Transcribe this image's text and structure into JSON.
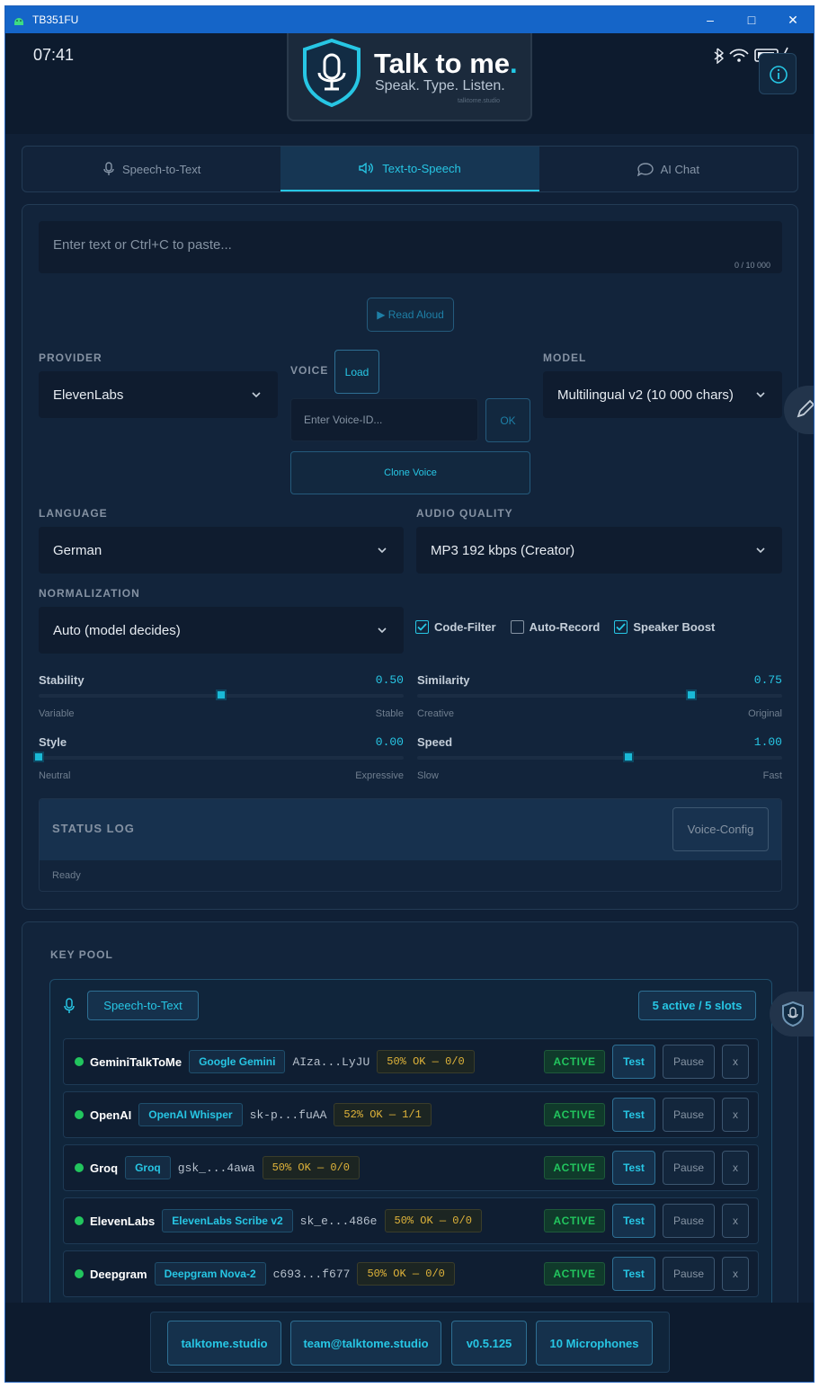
{
  "window": {
    "title": "TB351FU"
  },
  "statusbar": {
    "time": "07:41"
  },
  "logo": {
    "title": "Talk to me",
    "dot": ".",
    "subtitle": "Speak. Type. Listen.",
    "tiny": "talktome.studio"
  },
  "tabs": [
    {
      "label": "Speech-to-Text",
      "icon": "microphone-icon"
    },
    {
      "label": "Text-to-Speech",
      "icon": "speaker-icon"
    },
    {
      "label": "AI Chat",
      "icon": "chat-icon"
    }
  ],
  "tts": {
    "input_placeholder": "Enter text or Ctrl+C to paste...",
    "char_count": "0 / 10 000",
    "read_aloud": "▶ Read Aloud",
    "provider_label": "PROVIDER",
    "provider_value": "ElevenLabs",
    "voice_label": "VOICE",
    "load_label": "Load",
    "voice_placeholder": "Enter Voice-ID...",
    "ok_label": "OK",
    "clone_label": "Clone Voice",
    "model_label": "MODEL",
    "model_value": "Multilingual v2 (10 000 chars)",
    "language_label": "LANGUAGE",
    "language_value": "German",
    "quality_label": "AUDIO QUALITY",
    "quality_value": "MP3 192 kbps (Creator)",
    "normalization_label": "NORMALIZATION",
    "normalization_value": "Auto (model decides)",
    "checks": [
      {
        "label": "Code-Filter",
        "checked": true
      },
      {
        "label": "Auto-Record",
        "checked": false
      },
      {
        "label": "Speaker Boost",
        "checked": true
      }
    ],
    "sliders": [
      {
        "name": "Stability",
        "value": "0.50",
        "fraction": 0.5,
        "lo": "Variable",
        "hi": "Stable"
      },
      {
        "name": "Similarity",
        "value": "0.75",
        "fraction": 0.75,
        "lo": "Creative",
        "hi": "Original"
      },
      {
        "name": "Style",
        "value": "0.00",
        "fraction": 0.0,
        "lo": "Neutral",
        "hi": "Expressive"
      },
      {
        "name": "Speed",
        "value": "1.00",
        "fraction": 0.58,
        "lo": "Slow",
        "hi": "Fast"
      }
    ],
    "status_title": "STATUS LOG",
    "voice_config": "Voice-Config",
    "status_text": "Ready"
  },
  "pool": {
    "title": "KEY POOL",
    "service": "Speech-to-Text",
    "slots": "5 active / 5 slots",
    "rows": [
      {
        "name": "GeminiTalkToMe",
        "provider": "Google Gemini",
        "key": "AIza...LyJU",
        "ok": "50% OK — 0/0",
        "status": "ACTIVE",
        "test": "Test",
        "pause": "Pause",
        "remove": "x"
      },
      {
        "name": "OpenAI",
        "provider": "OpenAI Whisper",
        "key": "sk-p...fuAA",
        "ok": "52% OK — 1/1",
        "status": "ACTIVE",
        "test": "Test",
        "pause": "Pause",
        "remove": "x"
      },
      {
        "name": "Groq",
        "provider": "Groq",
        "key": "gsk_...4awa",
        "ok": "50% OK — 0/0",
        "status": "ACTIVE",
        "test": "Test",
        "pause": "Pause",
        "remove": "x"
      },
      {
        "name": "ElevenLabs",
        "provider": "ElevenLabs Scribe v2",
        "key": "sk_e...486e",
        "ok": "50% OK — 0/0",
        "status": "ACTIVE",
        "test": "Test",
        "pause": "Pause",
        "remove": "x"
      },
      {
        "name": "Deepgram",
        "provider": "Deepgram Nova-2",
        "key": "c693...f677",
        "ok": "50% OK — 0/0",
        "status": "ACTIVE",
        "test": "Test",
        "pause": "Pause",
        "remove": "x"
      }
    ]
  },
  "footer": {
    "site": "talktome.studio",
    "email": "team@talktome.studio",
    "version": "v0.5.125",
    "mics": "10 Microphones"
  },
  "colors": {
    "accent": "#27c6e4",
    "active_green": "#22c55e",
    "warn": "#e0b43a",
    "titlebar": "#1565c8"
  }
}
